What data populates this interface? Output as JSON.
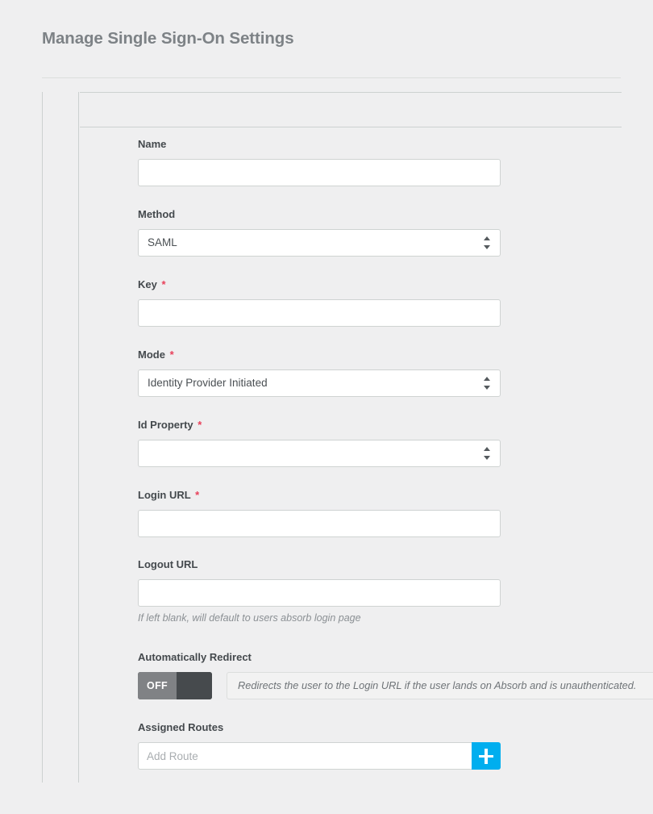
{
  "page": {
    "title": "Manage Single Sign-On Settings",
    "accent_color": "#00aeef",
    "required_marker": "*",
    "label_color": "#44494d",
    "title_color": "#7d8286",
    "background_color": "#efeff0"
  },
  "form": {
    "fields": [
      {
        "key": "name",
        "label": "Name",
        "type": "text",
        "required": false,
        "value": "",
        "placeholder": ""
      },
      {
        "key": "method",
        "label": "Method",
        "type": "select",
        "required": false,
        "value": "SAML"
      },
      {
        "key": "key",
        "label": "Key",
        "type": "text",
        "required": true,
        "value": "",
        "placeholder": ""
      },
      {
        "key": "mode",
        "label": "Mode",
        "type": "select",
        "required": true,
        "value": "Identity Provider Initiated"
      },
      {
        "key": "id_property",
        "label": "Id Property",
        "type": "select",
        "required": true,
        "value": ""
      },
      {
        "key": "login_url",
        "label": "Login URL",
        "type": "text",
        "required": true,
        "value": "",
        "placeholder": ""
      },
      {
        "key": "logout_url",
        "label": "Logout URL",
        "type": "text",
        "required": false,
        "value": "",
        "placeholder": "",
        "hint": "If left blank, will default to users absorb login page"
      },
      {
        "key": "automatically_redirect",
        "label": "Automatically Redirect",
        "type": "toggle",
        "required": false,
        "state_label": "OFF",
        "state": "off",
        "hint": "Redirects the user to the Login URL if the user lands on Absorb and is unauthenticated.",
        "off_color": "#808285",
        "knob_color": "#464a4d"
      },
      {
        "key": "assigned_routes",
        "label": "Assigned Routes",
        "type": "add-list",
        "required": false,
        "value": "",
        "placeholder": "Add Route",
        "add_button_icon": "plus-icon"
      }
    ]
  }
}
